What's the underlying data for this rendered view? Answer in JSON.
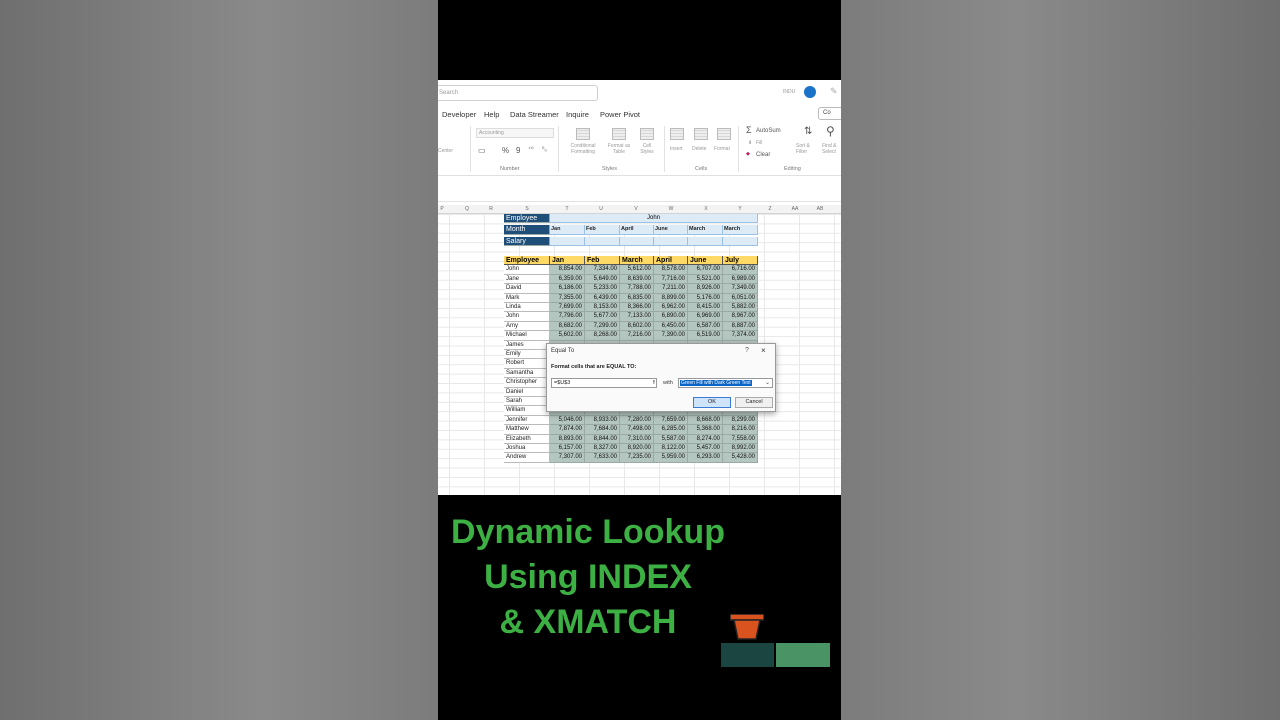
{
  "search": {
    "placeholder": "Search"
  },
  "user": {
    "name": "INDU"
  },
  "menu": [
    "Developer",
    "Help",
    "Data Streamer",
    "Inquire",
    "Power Pivot"
  ],
  "comments_label": "Co",
  "ribbon": {
    "alignment": {
      "center": "Center"
    },
    "number": {
      "format": "Accounting",
      "percent": "%",
      "comma": "9",
      "group": "Number"
    },
    "styles": {
      "conditional": "Conditional Formatting",
      "format_table": "Format as Table",
      "cell_styles": "Cell Styles",
      "group": "Styles"
    },
    "cells": {
      "insert": "Insert",
      "delete": "Delete",
      "format": "Format",
      "group": "Cells"
    },
    "editing": {
      "autosum": "AutoSum",
      "fill": "Fill",
      "clear": "Clear",
      "sort": "Sort & Filter",
      "find": "Find & Select",
      "group": "Editing"
    }
  },
  "columns": [
    "P",
    "Q",
    "R",
    "S",
    "T",
    "U",
    "V",
    "W",
    "X",
    "Y",
    "Z",
    "AA",
    "AB"
  ],
  "lookup": {
    "row_labels": [
      "Employee",
      "Month",
      "Salary"
    ],
    "employee": "John",
    "months": [
      "Jan",
      "Feb",
      "April",
      "June",
      "March",
      "March"
    ]
  },
  "table": {
    "headers": [
      "Employee",
      "Jan",
      "Feb",
      "March",
      "April",
      "June",
      "July"
    ],
    "rows": [
      [
        "John",
        "8,854.00",
        "7,334.00",
        "5,612.00",
        "8,578.00",
        "6,707.00",
        "6,716.00"
      ],
      [
        "Jane",
        "6,359.00",
        "5,649.00",
        "8,639.00",
        "7,716.00",
        "5,521.00",
        "6,989.00"
      ],
      [
        "David",
        "6,186.00",
        "5,233.00",
        "7,788.00",
        "7,211.00",
        "8,926.00",
        "7,349.00"
      ],
      [
        "Mark",
        "7,355.00",
        "6,439.00",
        "6,835.00",
        "8,899.00",
        "5,176.00",
        "6,051.00"
      ],
      [
        "Linda",
        "7,699.00",
        "8,153.00",
        "8,366.00",
        "6,962.00",
        "8,415.00",
        "5,882.00"
      ],
      [
        "John",
        "7,796.00",
        "5,677.00",
        "7,133.00",
        "6,890.00",
        "6,969.00",
        "8,967.00"
      ],
      [
        "Amy",
        "8,682.00",
        "7,299.00",
        "8,602.00",
        "6,450.00",
        "6,587.00",
        "8,887.00"
      ],
      [
        "Michael",
        "5,602.00",
        "8,268.00",
        "7,216.00",
        "7,390.00",
        "6,519.00",
        "7,374.00"
      ],
      [
        "James",
        "",
        "",
        "",
        "",
        "",
        ""
      ],
      [
        "Emily",
        "",
        "",
        "",
        "",
        "",
        ""
      ],
      [
        "Robert",
        "",
        "",
        "",
        "",
        "",
        ""
      ],
      [
        "Samantha",
        "",
        "",
        "",
        "",
        "",
        ""
      ],
      [
        "Christopher",
        "",
        "",
        "",
        "",
        "",
        ""
      ],
      [
        "Daniel",
        "",
        "",
        "",
        "",
        "",
        ""
      ],
      [
        "Sarah",
        "",
        "",
        "",
        "",
        "",
        ""
      ],
      [
        "William",
        "",
        "",
        "",
        "",
        "",
        ""
      ],
      [
        "Jennifer",
        "5,046.00",
        "8,933.00",
        "7,280.00",
        "7,659.00",
        "8,668.00",
        "8,299.00"
      ],
      [
        "Matthew",
        "7,874.00",
        "7,684.00",
        "7,498.00",
        "6,285.00",
        "5,368.00",
        "8,216.00"
      ],
      [
        "Elizabeth",
        "8,893.00",
        "8,844.00",
        "7,310.00",
        "5,587.00",
        "8,274.00",
        "7,558.00"
      ],
      [
        "Joshua",
        "6,157.00",
        "8,327.00",
        "8,920.00",
        "8,122.00",
        "5,457.00",
        "8,992.00"
      ],
      [
        "Andrew",
        "7,307.00",
        "7,633.00",
        "7,235.00",
        "5,959.00",
        "6,293.00",
        "5,428.00"
      ]
    ]
  },
  "dialog": {
    "title": "Equal To",
    "help": "?",
    "close": "×",
    "label": "Format cells that are EQUAL TO:",
    "input_value": "=$U$3",
    "with_label": "with",
    "format_option": "Green Fill with Dark Green Text",
    "ok": "OK",
    "cancel": "Cancel"
  },
  "caption": [
    "Dynamic Lookup",
    "Using INDEX",
    "& XMATCH"
  ]
}
